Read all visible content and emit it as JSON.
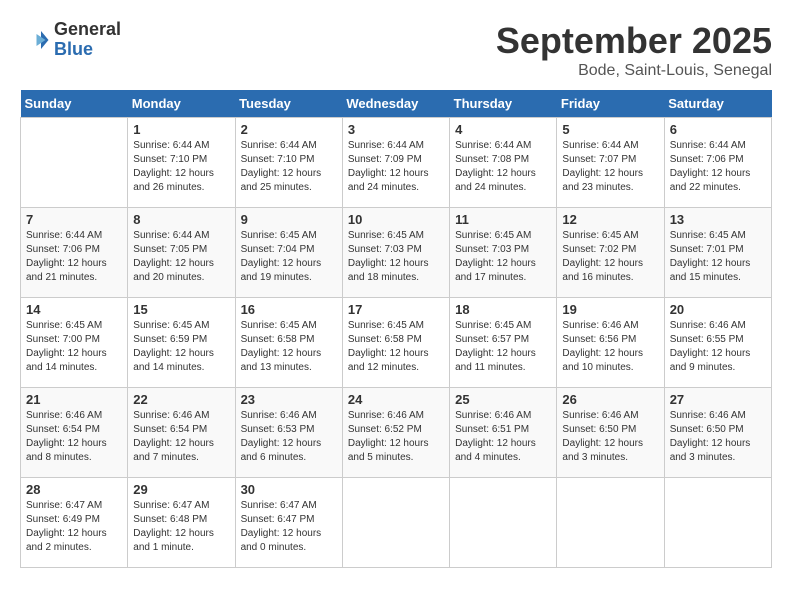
{
  "logo": {
    "general": "General",
    "blue": "Blue"
  },
  "header": {
    "month": "September 2025",
    "location": "Bode, Saint-Louis, Senegal"
  },
  "weekdays": [
    "Sunday",
    "Monday",
    "Tuesday",
    "Wednesday",
    "Thursday",
    "Friday",
    "Saturday"
  ],
  "weeks": [
    [
      {
        "day": "",
        "sunrise": "",
        "sunset": "",
        "daylight": ""
      },
      {
        "day": "1",
        "sunrise": "Sunrise: 6:44 AM",
        "sunset": "Sunset: 7:10 PM",
        "daylight": "Daylight: 12 hours and 26 minutes."
      },
      {
        "day": "2",
        "sunrise": "Sunrise: 6:44 AM",
        "sunset": "Sunset: 7:10 PM",
        "daylight": "Daylight: 12 hours and 25 minutes."
      },
      {
        "day": "3",
        "sunrise": "Sunrise: 6:44 AM",
        "sunset": "Sunset: 7:09 PM",
        "daylight": "Daylight: 12 hours and 24 minutes."
      },
      {
        "day": "4",
        "sunrise": "Sunrise: 6:44 AM",
        "sunset": "Sunset: 7:08 PM",
        "daylight": "Daylight: 12 hours and 24 minutes."
      },
      {
        "day": "5",
        "sunrise": "Sunrise: 6:44 AM",
        "sunset": "Sunset: 7:07 PM",
        "daylight": "Daylight: 12 hours and 23 minutes."
      },
      {
        "day": "6",
        "sunrise": "Sunrise: 6:44 AM",
        "sunset": "Sunset: 7:06 PM",
        "daylight": "Daylight: 12 hours and 22 minutes."
      }
    ],
    [
      {
        "day": "7",
        "sunrise": "Sunrise: 6:44 AM",
        "sunset": "Sunset: 7:06 PM",
        "daylight": "Daylight: 12 hours and 21 minutes."
      },
      {
        "day": "8",
        "sunrise": "Sunrise: 6:44 AM",
        "sunset": "Sunset: 7:05 PM",
        "daylight": "Daylight: 12 hours and 20 minutes."
      },
      {
        "day": "9",
        "sunrise": "Sunrise: 6:45 AM",
        "sunset": "Sunset: 7:04 PM",
        "daylight": "Daylight: 12 hours and 19 minutes."
      },
      {
        "day": "10",
        "sunrise": "Sunrise: 6:45 AM",
        "sunset": "Sunset: 7:03 PM",
        "daylight": "Daylight: 12 hours and 18 minutes."
      },
      {
        "day": "11",
        "sunrise": "Sunrise: 6:45 AM",
        "sunset": "Sunset: 7:03 PM",
        "daylight": "Daylight: 12 hours and 17 minutes."
      },
      {
        "day": "12",
        "sunrise": "Sunrise: 6:45 AM",
        "sunset": "Sunset: 7:02 PM",
        "daylight": "Daylight: 12 hours and 16 minutes."
      },
      {
        "day": "13",
        "sunrise": "Sunrise: 6:45 AM",
        "sunset": "Sunset: 7:01 PM",
        "daylight": "Daylight: 12 hours and 15 minutes."
      }
    ],
    [
      {
        "day": "14",
        "sunrise": "Sunrise: 6:45 AM",
        "sunset": "Sunset: 7:00 PM",
        "daylight": "Daylight: 12 hours and 14 minutes."
      },
      {
        "day": "15",
        "sunrise": "Sunrise: 6:45 AM",
        "sunset": "Sunset: 6:59 PM",
        "daylight": "Daylight: 12 hours and 14 minutes."
      },
      {
        "day": "16",
        "sunrise": "Sunrise: 6:45 AM",
        "sunset": "Sunset: 6:58 PM",
        "daylight": "Daylight: 12 hours and 13 minutes."
      },
      {
        "day": "17",
        "sunrise": "Sunrise: 6:45 AM",
        "sunset": "Sunset: 6:58 PM",
        "daylight": "Daylight: 12 hours and 12 minutes."
      },
      {
        "day": "18",
        "sunrise": "Sunrise: 6:45 AM",
        "sunset": "Sunset: 6:57 PM",
        "daylight": "Daylight: 12 hours and 11 minutes."
      },
      {
        "day": "19",
        "sunrise": "Sunrise: 6:46 AM",
        "sunset": "Sunset: 6:56 PM",
        "daylight": "Daylight: 12 hours and 10 minutes."
      },
      {
        "day": "20",
        "sunrise": "Sunrise: 6:46 AM",
        "sunset": "Sunset: 6:55 PM",
        "daylight": "Daylight: 12 hours and 9 minutes."
      }
    ],
    [
      {
        "day": "21",
        "sunrise": "Sunrise: 6:46 AM",
        "sunset": "Sunset: 6:54 PM",
        "daylight": "Daylight: 12 hours and 8 minutes."
      },
      {
        "day": "22",
        "sunrise": "Sunrise: 6:46 AM",
        "sunset": "Sunset: 6:54 PM",
        "daylight": "Daylight: 12 hours and 7 minutes."
      },
      {
        "day": "23",
        "sunrise": "Sunrise: 6:46 AM",
        "sunset": "Sunset: 6:53 PM",
        "daylight": "Daylight: 12 hours and 6 minutes."
      },
      {
        "day": "24",
        "sunrise": "Sunrise: 6:46 AM",
        "sunset": "Sunset: 6:52 PM",
        "daylight": "Daylight: 12 hours and 5 minutes."
      },
      {
        "day": "25",
        "sunrise": "Sunrise: 6:46 AM",
        "sunset": "Sunset: 6:51 PM",
        "daylight": "Daylight: 12 hours and 4 minutes."
      },
      {
        "day": "26",
        "sunrise": "Sunrise: 6:46 AM",
        "sunset": "Sunset: 6:50 PM",
        "daylight": "Daylight: 12 hours and 3 minutes."
      },
      {
        "day": "27",
        "sunrise": "Sunrise: 6:46 AM",
        "sunset": "Sunset: 6:50 PM",
        "daylight": "Daylight: 12 hours and 3 minutes."
      }
    ],
    [
      {
        "day": "28",
        "sunrise": "Sunrise: 6:47 AM",
        "sunset": "Sunset: 6:49 PM",
        "daylight": "Daylight: 12 hours and 2 minutes."
      },
      {
        "day": "29",
        "sunrise": "Sunrise: 6:47 AM",
        "sunset": "Sunset: 6:48 PM",
        "daylight": "Daylight: 12 hours and 1 minute."
      },
      {
        "day": "30",
        "sunrise": "Sunrise: 6:47 AM",
        "sunset": "Sunset: 6:47 PM",
        "daylight": "Daylight: 12 hours and 0 minutes."
      },
      {
        "day": "",
        "sunrise": "",
        "sunset": "",
        "daylight": ""
      },
      {
        "day": "",
        "sunrise": "",
        "sunset": "",
        "daylight": ""
      },
      {
        "day": "",
        "sunrise": "",
        "sunset": "",
        "daylight": ""
      },
      {
        "day": "",
        "sunrise": "",
        "sunset": "",
        "daylight": ""
      }
    ]
  ]
}
